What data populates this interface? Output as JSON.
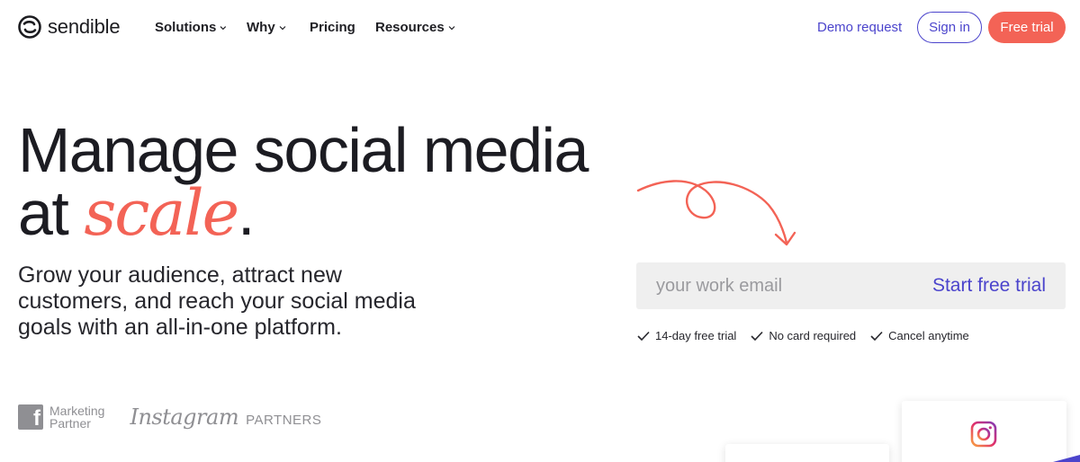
{
  "brand": {
    "name": "sendible"
  },
  "nav": {
    "items": [
      {
        "label": "Solutions",
        "has_dropdown": true
      },
      {
        "label": "Why",
        "has_dropdown": true
      },
      {
        "label": "Pricing",
        "has_dropdown": false
      },
      {
        "label": "Resources",
        "has_dropdown": true
      }
    ],
    "demo_label": "Demo request",
    "signin_label": "Sign in",
    "trial_label": "Free trial"
  },
  "hero": {
    "title_line1": "Manage social media",
    "title_line2_prefix": "at ",
    "title_accent": "scale",
    "title_suffix": ".",
    "subtitle": "Grow your audience, attract new customers, and reach your social media goals with an all-in-one platform."
  },
  "signup": {
    "email_placeholder": "your work email",
    "email_value": "",
    "submit_label": "Start free trial",
    "perks": [
      "14-day free trial",
      "No card required",
      "Cancel anytime"
    ]
  },
  "partners": {
    "facebook_line1": "Marketing",
    "facebook_line2": "Partner",
    "instagram_word": "Instagram",
    "instagram_suffix": "PARTNERS"
  },
  "colors": {
    "accent_purple": "#4b44cc",
    "accent_coral": "#f36356",
    "text_dark": "#1c1c22",
    "muted_gray": "#8f8f93",
    "input_bg": "#efefef"
  },
  "icons": [
    "sendible-logo-icon",
    "chevron-down-icon",
    "curly-arrow-icon",
    "check-icon",
    "facebook-icon",
    "instagram-icon"
  ]
}
